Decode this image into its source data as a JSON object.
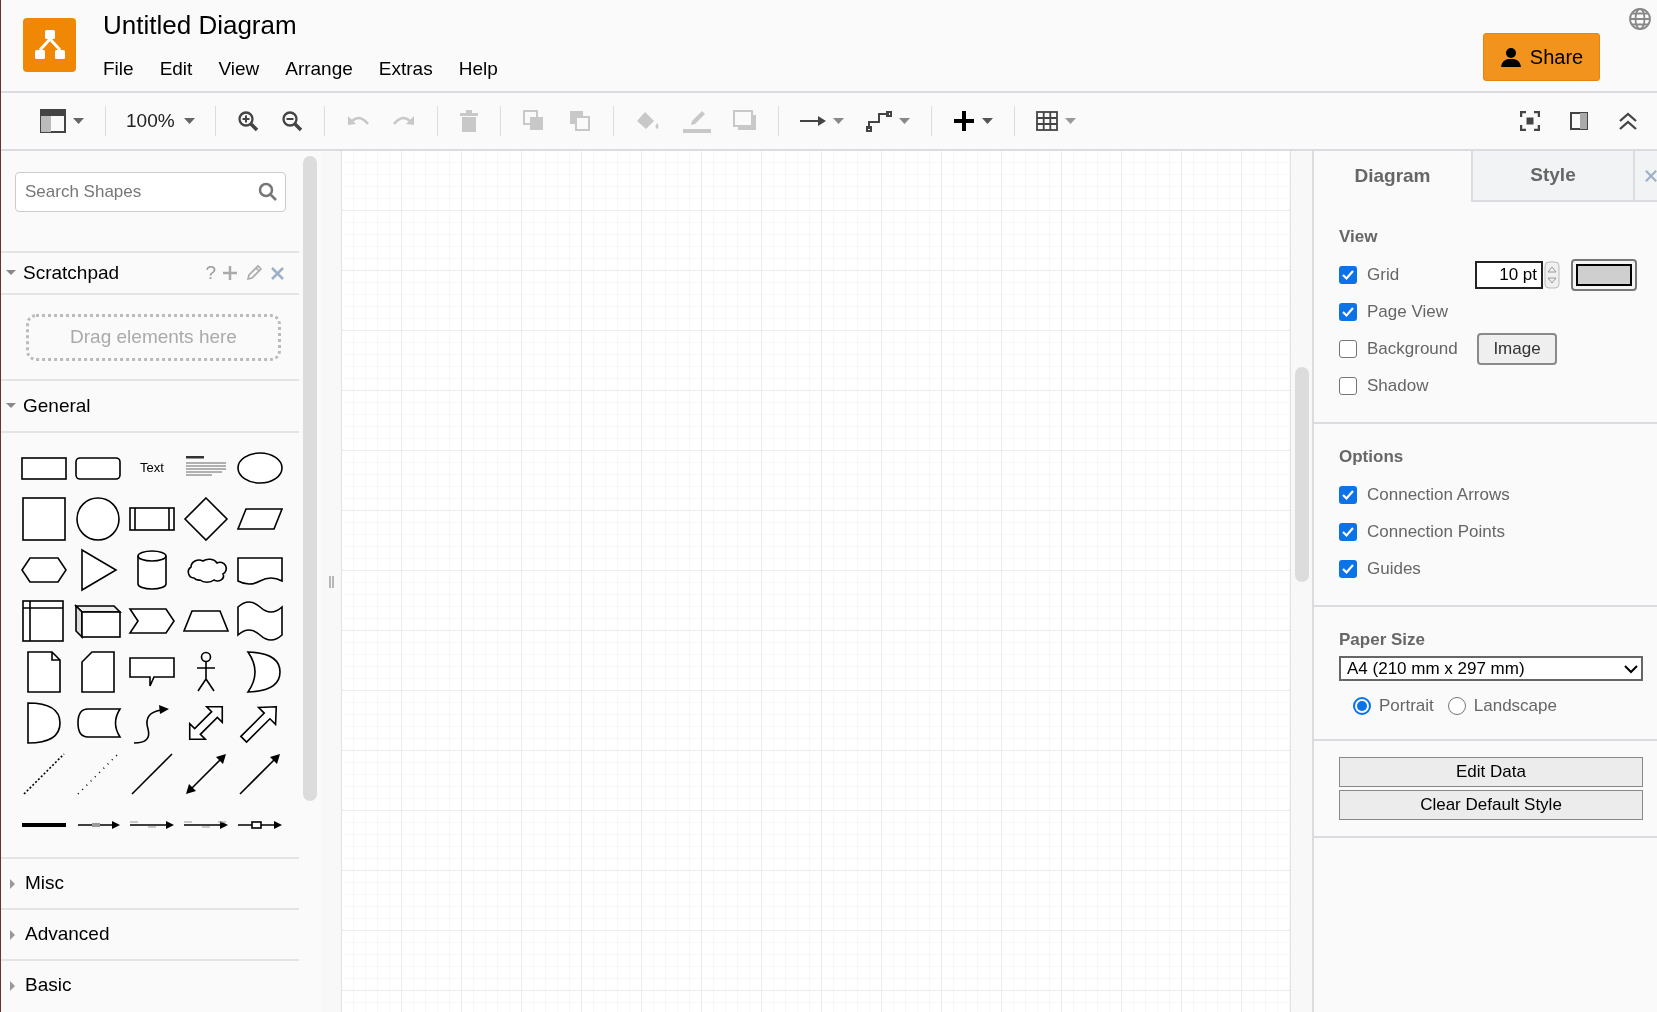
{
  "app": {
    "title": "Untitled Diagram"
  },
  "menu": [
    "File",
    "Edit",
    "View",
    "Arrange",
    "Extras",
    "Help"
  ],
  "share_button": "Share",
  "toolbar": {
    "items": [
      {
        "kind": "format",
        "disabled": false
      },
      {
        "kind": "separator"
      },
      {
        "kind": "zoom",
        "label": "100%",
        "disabled": false
      },
      {
        "kind": "separator"
      },
      {
        "kind": "zoom_in",
        "disabled": false
      },
      {
        "kind": "zoom_out",
        "disabled": false
      },
      {
        "kind": "separator"
      },
      {
        "kind": "undo",
        "disabled": true
      },
      {
        "kind": "redo",
        "disabled": true
      },
      {
        "kind": "separator"
      },
      {
        "kind": "delete",
        "disabled": true
      },
      {
        "kind": "separator"
      },
      {
        "kind": "to_front",
        "disabled": true
      },
      {
        "kind": "to_back",
        "disabled": true
      },
      {
        "kind": "separator"
      },
      {
        "kind": "fill_color",
        "disabled": true
      },
      {
        "kind": "line_color",
        "disabled": true
      },
      {
        "kind": "shadow",
        "disabled": true
      },
      {
        "kind": "separator"
      },
      {
        "kind": "connection",
        "disabled": false
      },
      {
        "kind": "waypoints",
        "disabled": false
      },
      {
        "kind": "separator"
      },
      {
        "kind": "insert",
        "disabled": false
      },
      {
        "kind": "separator"
      },
      {
        "kind": "table",
        "disabled": false
      }
    ],
    "right_items": [
      {
        "kind": "fullscreen",
        "disabled": false
      },
      {
        "kind": "format_panel",
        "disabled": false
      },
      {
        "kind": "collapse",
        "disabled": false
      }
    ]
  },
  "sidebar": {
    "search": {
      "placeholder": "Search Shapes"
    },
    "scratchpad": {
      "title": "Scratchpad",
      "expanded": true,
      "help": "?",
      "hint": "Drag elements here"
    },
    "general": {
      "title": "General",
      "expanded": true,
      "shapes": [
        {
          "kind": "rectangle"
        },
        {
          "kind": "rounded-rectangle"
        },
        {
          "kind": "text",
          "label": "Text"
        },
        {
          "kind": "heading"
        },
        {
          "kind": "ellipse"
        },
        {
          "kind": "square"
        },
        {
          "kind": "circle"
        },
        {
          "kind": "process"
        },
        {
          "kind": "diamond"
        },
        {
          "kind": "parallelogram"
        },
        {
          "kind": "hexagon"
        },
        {
          "kind": "triangle"
        },
        {
          "kind": "cylinder"
        },
        {
          "kind": "cloud"
        },
        {
          "kind": "document"
        },
        {
          "kind": "internal-storage"
        },
        {
          "kind": "cube"
        },
        {
          "kind": "step"
        },
        {
          "kind": "trapezoid"
        },
        {
          "kind": "tape"
        },
        {
          "kind": "note"
        },
        {
          "kind": "card"
        },
        {
          "kind": "callout"
        },
        {
          "kind": "actor"
        },
        {
          "kind": "crescent"
        },
        {
          "kind": "half-circle"
        },
        {
          "kind": "data-storage"
        },
        {
          "kind": "curved-arrow"
        },
        {
          "kind": "double-block-arrow"
        },
        {
          "kind": "block-arrow"
        },
        {
          "kind": "dashed-line"
        },
        {
          "kind": "dotted-line"
        },
        {
          "kind": "line"
        },
        {
          "kind": "double-arrow-line"
        },
        {
          "kind": "arrow-line"
        },
        {
          "kind": "thick-line"
        },
        {
          "kind": "labeled-connector"
        },
        {
          "kind": "two-label-connector"
        },
        {
          "kind": "three-label-connector"
        },
        {
          "kind": "symbol-connector"
        }
      ]
    },
    "sections": [
      {
        "title": "Misc",
        "expanded": false
      },
      {
        "title": "Advanced",
        "expanded": false
      },
      {
        "title": "Basic",
        "expanded": false
      }
    ]
  },
  "format_panel": {
    "tabs": [
      {
        "label": "Diagram",
        "selected": true
      },
      {
        "label": "Style",
        "selected": false
      }
    ],
    "view": {
      "title": "View",
      "options": [
        {
          "kind": "grid",
          "label": "Grid",
          "checked": true,
          "size": "10 pt"
        },
        {
          "kind": "plain",
          "label": "Page View",
          "checked": true
        },
        {
          "kind": "background",
          "label": "Background",
          "checked": false,
          "button": "Image"
        },
        {
          "kind": "plain",
          "label": "Shadow",
          "checked": false
        }
      ]
    },
    "options": {
      "title": "Options",
      "options": [
        {
          "label": "Connection Arrows",
          "checked": true
        },
        {
          "label": "Connection Points",
          "checked": true
        },
        {
          "label": "Guides",
          "checked": true
        }
      ]
    },
    "paper_size": {
      "title": "Paper Size",
      "value": "A4 (210 mm x 297 mm)",
      "orientations": [
        {
          "label": "Portrait",
          "selected": true
        },
        {
          "label": "Landscape",
          "selected": false
        }
      ]
    },
    "buttons": [
      "Edit Data",
      "Clear Default Style"
    ]
  }
}
